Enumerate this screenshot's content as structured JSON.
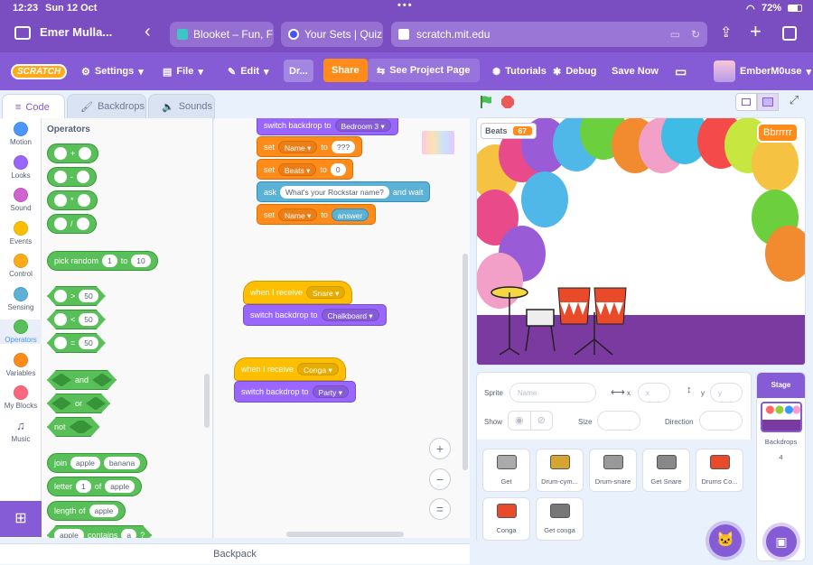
{
  "status": {
    "time": "12:23",
    "date": "Sun 12 Oct",
    "battery": "72%"
  },
  "browser": {
    "profile": "Emer Mulla...",
    "tabs": [
      {
        "label": "Blooket – Fun, F"
      },
      {
        "label": "Your Sets | Quiz"
      }
    ],
    "url": "scratch.mit.edu"
  },
  "menu": {
    "logo": "SCRATCH",
    "settings": "Settings",
    "file": "File",
    "edit": "Edit",
    "project_title": "Dr...",
    "share": "Share",
    "see_project": "See Project Page",
    "tutorials": "Tutorials",
    "debug": "Debug",
    "save_now": "Save Now",
    "username": "EmberM0use"
  },
  "editor_tabs": {
    "code": "Code",
    "backdrops": "Backdrops",
    "sounds": "Sounds"
  },
  "categories": [
    {
      "label": "Motion",
      "color": "#4c97ff"
    },
    {
      "label": "Looks",
      "color": "#9966ff"
    },
    {
      "label": "Sound",
      "color": "#cf63cf"
    },
    {
      "label": "Events",
      "color": "#ffbf00"
    },
    {
      "label": "Control",
      "color": "#ffab19"
    },
    {
      "label": "Sensing",
      "color": "#5cb1d6"
    },
    {
      "label": "Operators",
      "color": "#59c059"
    },
    {
      "label": "Variables",
      "color": "#ff8c1a"
    },
    {
      "label": "My Blocks",
      "color": "#ff6680"
    },
    {
      "label": "Music",
      "color": "#575e75"
    }
  ],
  "palette": {
    "heading": "Operators",
    "arith": [
      "+",
      "-",
      "*",
      "/"
    ],
    "pick_random": {
      "label": "pick random",
      "from": "1",
      "to_label": "to",
      "to": "10"
    },
    "compare": [
      {
        "op": ">",
        "val": "50"
      },
      {
        "op": "<",
        "val": "50"
      },
      {
        "op": "=",
        "val": "50"
      }
    ],
    "logic": [
      "and",
      "or",
      "not"
    ],
    "join": {
      "label": "join",
      "a": "apple",
      "b": "banana"
    },
    "letter": {
      "label": "letter",
      "n": "1",
      "of": "of",
      "s": "apple"
    },
    "length": {
      "label": "length of",
      "s": "apple"
    },
    "contains": {
      "s": "apple",
      "label": "contains",
      "c": "a",
      "q": "?"
    }
  },
  "script1": {
    "switch_backdrop": {
      "label": "switch backdrop to",
      "value": "Bedroom 3"
    },
    "set1": {
      "set": "set",
      "var": "Name",
      "to": "to",
      "val": "???"
    },
    "set2": {
      "set": "set",
      "var": "Beats",
      "to": "to",
      "val": "0"
    },
    "ask": {
      "label": "ask",
      "question": "What's your Rockstar name?",
      "wait": "and wait"
    },
    "set3": {
      "set": "set",
      "var": "Name",
      "to": "to",
      "val": "answer"
    }
  },
  "script2": {
    "hat": "when I receive",
    "msg": "Snare",
    "action": "switch backdrop to",
    "backdrop": "Chalkboard"
  },
  "script3": {
    "hat": "when I receive",
    "msg": "Conga",
    "action": "switch backdrop to",
    "backdrop": "Party"
  },
  "zoom": {
    "in": "+",
    "out": "−",
    "reset": "="
  },
  "backpack": "Backpack",
  "stage": {
    "var_name": "Beats",
    "var_value": "67",
    "speech": "Bbrrrrr"
  },
  "sprite_info": {
    "sprite_label": "Sprite",
    "name_placeholder": "Name",
    "x_label": "x",
    "x_placeholder": "x",
    "y_label": "y",
    "y_placeholder": "y",
    "show_label": "Show",
    "size_label": "Size",
    "direction_label": "Direction"
  },
  "sprites": [
    {
      "name": "Get"
    },
    {
      "name": "Drum-cym..."
    },
    {
      "name": "Drum-snare"
    },
    {
      "name": "Get Snare"
    },
    {
      "name": "Drums Co..."
    },
    {
      "name": "Conga"
    },
    {
      "name": "Get conga"
    }
  ],
  "stage_panel": {
    "title": "Stage",
    "backdrops_label": "Backdrops",
    "backdrops_count": "4"
  }
}
